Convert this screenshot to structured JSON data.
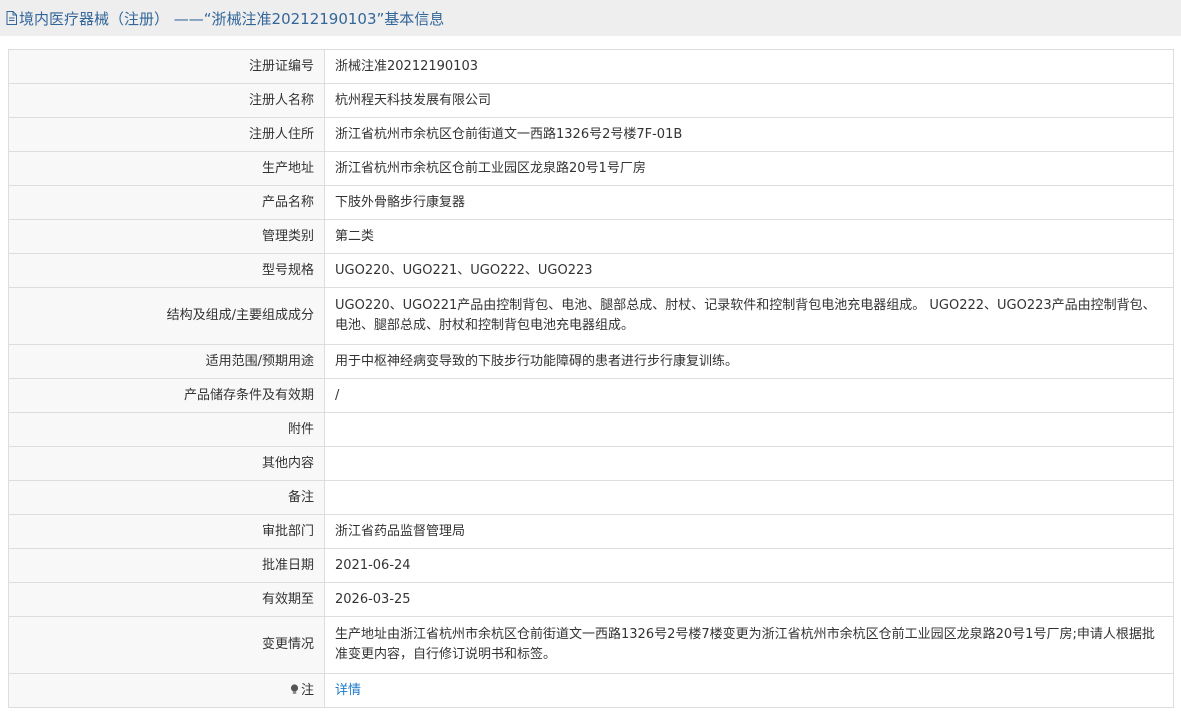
{
  "header": {
    "title": "境内医疗器械（注册） ——“浙械注准20212190103”基本信息"
  },
  "rows": [
    {
      "label": "注册证编号",
      "value": "浙械注准20212190103"
    },
    {
      "label": "注册人名称",
      "value": "杭州程天科技发展有限公司"
    },
    {
      "label": "注册人住所",
      "value": "浙江省杭州市余杭区仓前街道文一西路1326号2号楼7F-01B"
    },
    {
      "label": "生产地址",
      "value": "浙江省杭州市余杭区仓前工业园区龙泉路20号1号厂房"
    },
    {
      "label": "产品名称",
      "value": "下肢外骨骼步行康复器"
    },
    {
      "label": "管理类别",
      "value": "第二类"
    },
    {
      "label": "型号规格",
      "value": "UGO220、UGO221、UGO222、UGO223"
    },
    {
      "label": "结构及组成/主要组成成分",
      "value": "UGO220、UGO221产品由控制背包、电池、腿部总成、肘杖、记录软件和控制背包电池充电器组成。 UGO222、UGO223产品由控制背包、电池、腿部总成、肘杖和控制背包电池充电器组成。"
    },
    {
      "label": "适用范围/预期用途",
      "value": "用于中枢神经病变导致的下肢步行功能障碍的患者进行步行康复训练。"
    },
    {
      "label": "产品储存条件及有效期",
      "value": "/"
    },
    {
      "label": "附件",
      "value": ""
    },
    {
      "label": "其他内容",
      "value": ""
    },
    {
      "label": "备注",
      "value": ""
    },
    {
      "label": "审批部门",
      "value": "浙江省药品监督管理局"
    },
    {
      "label": "批准日期",
      "value": "2021-06-24"
    },
    {
      "label": "有效期至",
      "value": "2026-03-25"
    },
    {
      "label": "变更情况",
      "value": "生产地址由浙江省杭州市余杭区仓前街道文一西路1326号2号楼7楼变更为浙江省杭州市余杭区仓前工业园区龙泉路20号1号厂房;申请人根据批准变更内容，自行修订说明书和标签。"
    }
  ],
  "note": {
    "label": "注",
    "link": "详情",
    "icon": "lightbulb-icon"
  },
  "colors": {
    "header_bg": "#eeeeee",
    "header_text": "#336699",
    "label_bg": "#f8f8f8",
    "border": "#dddddd",
    "link": "#1e7ac9"
  }
}
